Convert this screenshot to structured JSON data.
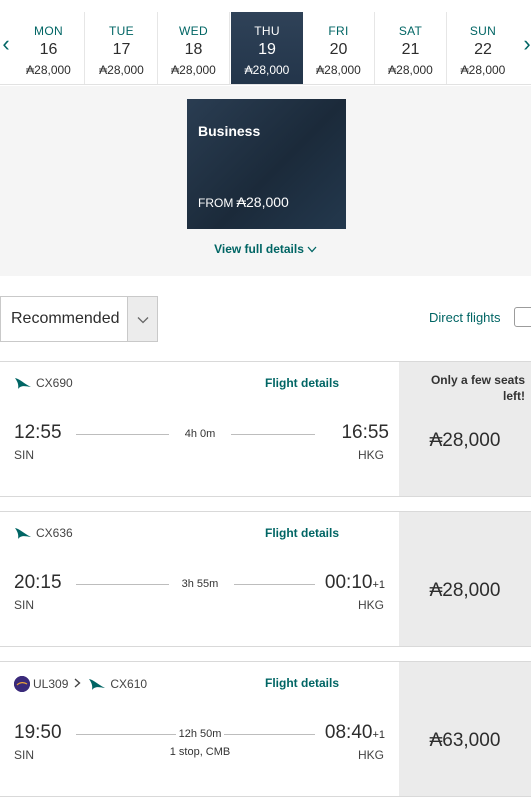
{
  "date_strip": {
    "prev_icon": "chevron-left-icon",
    "next_icon": "chevron-right-icon",
    "days": [
      {
        "dow": "MON",
        "day": "16",
        "price": "₳28,000",
        "selected": false
      },
      {
        "dow": "TUE",
        "day": "17",
        "price": "₳28,000",
        "selected": false
      },
      {
        "dow": "WED",
        "day": "18",
        "price": "₳28,000",
        "selected": false
      },
      {
        "dow": "THU",
        "day": "19",
        "price": "₳28,000",
        "selected": true
      },
      {
        "dow": "FRI",
        "day": "20",
        "price": "₳28,000",
        "selected": false
      },
      {
        "dow": "SAT",
        "day": "21",
        "price": "₳28,000",
        "selected": false
      },
      {
        "dow": "SUN",
        "day": "22",
        "price": "₳28,000",
        "selected": false
      }
    ]
  },
  "cabin": {
    "title": "Business",
    "from_label": "FROM",
    "from_price": "₳28,000",
    "view_details": "View full details",
    "view_details_icon": "chevron-down-icon"
  },
  "controls": {
    "sort_value": "Recommended",
    "sort_icon": "chevron-down-icon",
    "direct_label": "Direct flights"
  },
  "flights": [
    {
      "segments": [
        {
          "airline_icon": "cathay-logo-icon",
          "flight_no": "CX690"
        }
      ],
      "details_label": "Flight details",
      "dep_time": "12:55",
      "dep_code": "SIN",
      "duration": "4h 0m",
      "stops": "",
      "arr_time": "16:55",
      "arr_plus": "",
      "arr_code": "HKG",
      "note": "Only a few seats left!",
      "price": "₳28,000"
    },
    {
      "segments": [
        {
          "airline_icon": "cathay-logo-icon",
          "flight_no": "CX636"
        }
      ],
      "details_label": "Flight details",
      "dep_time": "20:15",
      "dep_code": "SIN",
      "duration": "3h 55m",
      "stops": "",
      "arr_time": "00:10",
      "arr_plus": "+1",
      "arr_code": "HKG",
      "note": "",
      "price": "₳28,000"
    },
    {
      "segments": [
        {
          "airline_icon": "srilankan-logo-icon",
          "flight_no": "UL309"
        },
        {
          "airline_icon": "cathay-logo-icon",
          "flight_no": "CX610"
        }
      ],
      "details_label": "Flight details",
      "dep_time": "19:50",
      "dep_code": "SIN",
      "duration": "12h 50m",
      "stops": "1 stop, CMB",
      "arr_time": "08:40",
      "arr_plus": "+1",
      "arr_code": "HKG",
      "note": "",
      "price": "₳63,000"
    }
  ],
  "colors": {
    "accent": "#006564",
    "selected_day": "#2c3e52",
    "price_panel": "#ebebeb"
  }
}
